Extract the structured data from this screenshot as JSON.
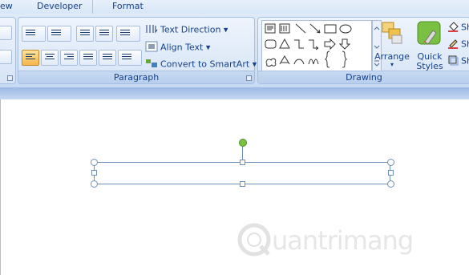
{
  "tabs": {
    "view_partial": "ew",
    "developer": "Developer",
    "format": "Format"
  },
  "paragraph": {
    "label": "Paragraph",
    "text_direction": "Text Direction",
    "align_text": "Align Text",
    "convert_smartart": "Convert to SmartArt"
  },
  "drawing": {
    "label": "Drawing",
    "arrange": "Arrange",
    "quick_styles_line1": "Quick",
    "quick_styles_line2": "Styles",
    "shape_fill_partial": "Sh",
    "shape_outline_partial": "Sh",
    "shape_effects_partial": "Sh"
  },
  "watermark": {
    "text": "uantrimang"
  },
  "colors": {
    "ribbon_text": "#15428b",
    "accent_orange": "#f6b64a",
    "rotate_handle": "#7ac143"
  }
}
